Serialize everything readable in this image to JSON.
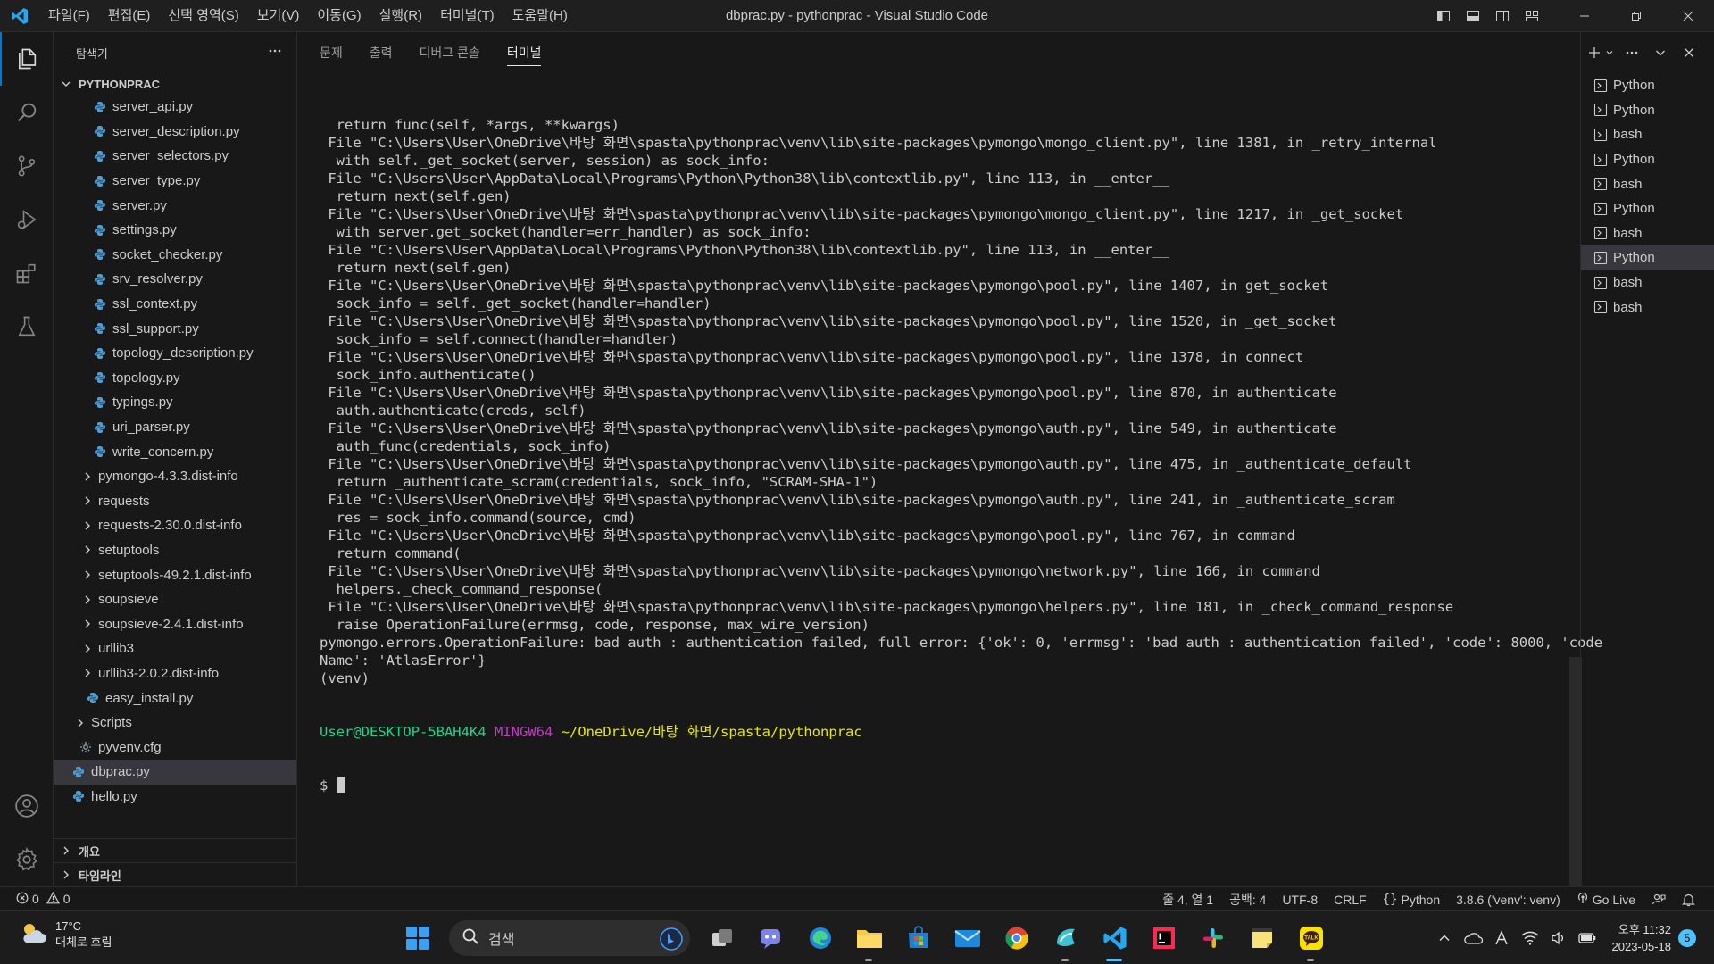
{
  "window": {
    "title": "dbprac.py - pythonprac - Visual Studio Code",
    "menu": [
      "파일(F)",
      "편집(E)",
      "선택 영역(S)",
      "보기(V)",
      "이동(G)",
      "실행(R)",
      "터미널(T)",
      "도움말(H)"
    ]
  },
  "sidebar": {
    "title": "탐색기",
    "project": "PYTHONPRAC",
    "items": [
      {
        "label": "server_api.py",
        "type": "py",
        "indent": 3
      },
      {
        "label": "server_description.py",
        "type": "py",
        "indent": 3
      },
      {
        "label": "server_selectors.py",
        "type": "py",
        "indent": 3
      },
      {
        "label": "server_type.py",
        "type": "py",
        "indent": 3
      },
      {
        "label": "server.py",
        "type": "py",
        "indent": 3
      },
      {
        "label": "settings.py",
        "type": "py",
        "indent": 3
      },
      {
        "label": "socket_checker.py",
        "type": "py",
        "indent": 3
      },
      {
        "label": "srv_resolver.py",
        "type": "py",
        "indent": 3
      },
      {
        "label": "ssl_context.py",
        "type": "py",
        "indent": 3
      },
      {
        "label": "ssl_support.py",
        "type": "py",
        "indent": 3
      },
      {
        "label": "topology_description.py",
        "type": "py",
        "indent": 3
      },
      {
        "label": "topology.py",
        "type": "py",
        "indent": 3
      },
      {
        "label": "typings.py",
        "type": "py",
        "indent": 3
      },
      {
        "label": "uri_parser.py",
        "type": "py",
        "indent": 3
      },
      {
        "label": "write_concern.py",
        "type": "py",
        "indent": 3
      },
      {
        "label": "pymongo-4.3.3.dist-info",
        "type": "folder",
        "indent": 2
      },
      {
        "label": "requests",
        "type": "folder",
        "indent": 2
      },
      {
        "label": "requests-2.30.0.dist-info",
        "type": "folder",
        "indent": 2
      },
      {
        "label": "setuptools",
        "type": "folder",
        "indent": 2
      },
      {
        "label": "setuptools-49.2.1.dist-info",
        "type": "folder",
        "indent": 2
      },
      {
        "label": "soupsieve",
        "type": "folder",
        "indent": 2
      },
      {
        "label": "soupsieve-2.4.1.dist-info",
        "type": "folder",
        "indent": 2
      },
      {
        "label": "urllib3",
        "type": "folder",
        "indent": 2
      },
      {
        "label": "urllib3-2.0.2.dist-info",
        "type": "folder",
        "indent": 2
      },
      {
        "label": "easy_install.py",
        "type": "py",
        "indent": 2
      },
      {
        "label": "Scripts",
        "type": "folder",
        "indent": 1
      },
      {
        "label": "pyvenv.cfg",
        "type": "cfg",
        "indent": 1
      },
      {
        "label": "dbprac.py",
        "type": "py",
        "indent": 0,
        "selected": true
      },
      {
        "label": "hello.py",
        "type": "py",
        "indent": 0
      }
    ],
    "outline": "개요",
    "timeline": "타임라인"
  },
  "panel": {
    "tabs": [
      "문제",
      "출력",
      "디버그 콘솔",
      "터미널"
    ],
    "active_tab": 3,
    "terminal_lines": [
      "  return func(self, *args, **kwargs)",
      " File \"C:\\Users\\User\\OneDrive\\바탕 화면\\spasta\\pythonprac\\venv\\lib\\site-packages\\pymongo\\mongo_client.py\", line 1381, in _retry_internal",
      "  with self._get_socket(server, session) as sock_info:",
      " File \"C:\\Users\\User\\AppData\\Local\\Programs\\Python\\Python38\\lib\\contextlib.py\", line 113, in __enter__",
      "  return next(self.gen)",
      " File \"C:\\Users\\User\\OneDrive\\바탕 화면\\spasta\\pythonprac\\venv\\lib\\site-packages\\pymongo\\mongo_client.py\", line 1217, in _get_socket",
      "  with server.get_socket(handler=err_handler) as sock_info:",
      " File \"C:\\Users\\User\\AppData\\Local\\Programs\\Python\\Python38\\lib\\contextlib.py\", line 113, in __enter__",
      "  return next(self.gen)",
      " File \"C:\\Users\\User\\OneDrive\\바탕 화면\\spasta\\pythonprac\\venv\\lib\\site-packages\\pymongo\\pool.py\", line 1407, in get_socket",
      "  sock_info = self._get_socket(handler=handler)",
      " File \"C:\\Users\\User\\OneDrive\\바탕 화면\\spasta\\pythonprac\\venv\\lib\\site-packages\\pymongo\\pool.py\", line 1520, in _get_socket",
      "  sock_info = self.connect(handler=handler)",
      " File \"C:\\Users\\User\\OneDrive\\바탕 화면\\spasta\\pythonprac\\venv\\lib\\site-packages\\pymongo\\pool.py\", line 1378, in connect",
      "  sock_info.authenticate()",
      " File \"C:\\Users\\User\\OneDrive\\바탕 화면\\spasta\\pythonprac\\venv\\lib\\site-packages\\pymongo\\pool.py\", line 870, in authenticate",
      "  auth.authenticate(creds, self)",
      " File \"C:\\Users\\User\\OneDrive\\바탕 화면\\spasta\\pythonprac\\venv\\lib\\site-packages\\pymongo\\auth.py\", line 549, in authenticate",
      "  auth_func(credentials, sock_info)",
      " File \"C:\\Users\\User\\OneDrive\\바탕 화면\\spasta\\pythonprac\\venv\\lib\\site-packages\\pymongo\\auth.py\", line 475, in _authenticate_default",
      "  return _authenticate_scram(credentials, sock_info, \"SCRAM-SHA-1\")",
      " File \"C:\\Users\\User\\OneDrive\\바탕 화면\\spasta\\pythonprac\\venv\\lib\\site-packages\\pymongo\\auth.py\", line 241, in _authenticate_scram",
      "  res = sock_info.command(source, cmd)",
      " File \"C:\\Users\\User\\OneDrive\\바탕 화면\\spasta\\pythonprac\\venv\\lib\\site-packages\\pymongo\\pool.py\", line 767, in command",
      "  return command(",
      " File \"C:\\Users\\User\\OneDrive\\바탕 화면\\spasta\\pythonprac\\venv\\lib\\site-packages\\pymongo\\network.py\", line 166, in command",
      "  helpers._check_command_response(",
      " File \"C:\\Users\\User\\OneDrive\\바탕 화면\\spasta\\pythonprac\\venv\\lib\\site-packages\\pymongo\\helpers.py\", line 181, in _check_command_response",
      "  raise OperationFailure(errmsg, code, response, max_wire_version)",
      "pymongo.errors.OperationFailure: bad auth : authentication failed, full error: {'ok': 0, 'errmsg': 'bad auth : authentication failed', 'code': 8000, 'code",
      "Name': 'AtlasError'}",
      "(venv)"
    ],
    "prompt": {
      "user": "User@DESKTOP-5BAH4K4",
      "shell": "MINGW64",
      "path": "~/OneDrive/바탕 화면/spasta/pythonprac",
      "symbol": "$"
    },
    "terminals": [
      {
        "label": "Python"
      },
      {
        "label": "Python"
      },
      {
        "label": "bash"
      },
      {
        "label": "Python"
      },
      {
        "label": "bash"
      },
      {
        "label": "Python"
      },
      {
        "label": "bash"
      },
      {
        "label": "Python",
        "active": true
      },
      {
        "label": "bash"
      },
      {
        "label": "bash"
      }
    ]
  },
  "statusbar": {
    "errors": "0",
    "warnings": "0",
    "position": "줄 4, 열 1",
    "spaces": "공백: 4",
    "encoding": "UTF-8",
    "eol": "CRLF",
    "language": "Python",
    "interpreter": "3.8.6 ('venv': venv)",
    "golive": "Go Live"
  },
  "taskbar": {
    "weather_temp": "17°C",
    "weather_desc": "대체로 흐림",
    "search_placeholder": "검색",
    "time": "오후 11:32",
    "date": "2023-05-18",
    "notifications": "5"
  },
  "colors": {
    "accent": "#0078d4",
    "prompt_user": "#23d18b",
    "prompt_shell": "#bc3fbc",
    "prompt_path": "#e5e510",
    "python_icon": "#4d9fd6"
  }
}
